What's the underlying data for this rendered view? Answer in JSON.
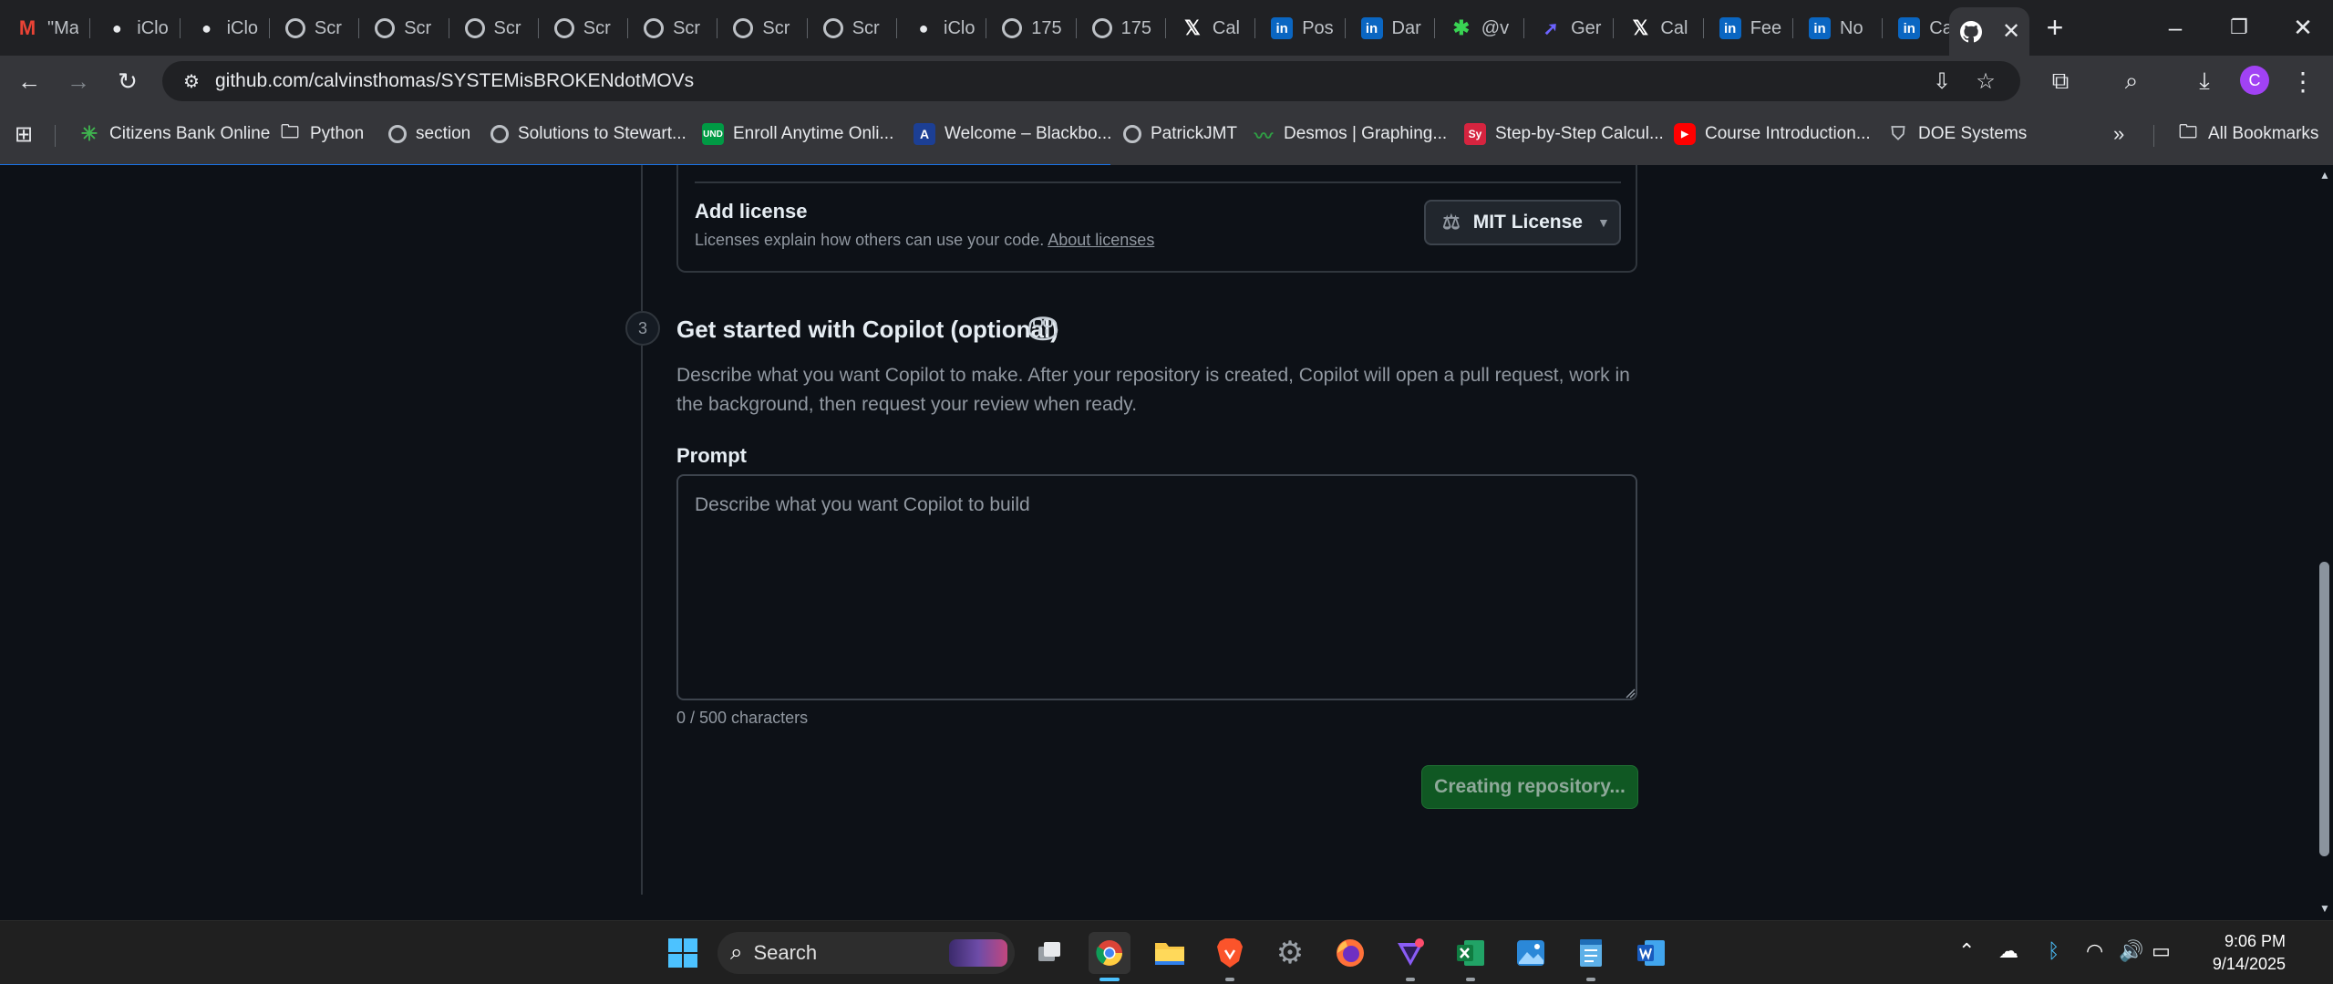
{
  "browser": {
    "tabs": [
      {
        "label": "\"Ma",
        "favicon": "gmail-icon"
      },
      {
        "label": "iClo",
        "favicon": "apple-icon"
      },
      {
        "label": "iClo",
        "favicon": "apple-icon"
      },
      {
        "label": "Scr",
        "favicon": "globe-icon"
      },
      {
        "label": "Scr",
        "favicon": "globe-icon"
      },
      {
        "label": "Scr",
        "favicon": "globe-icon"
      },
      {
        "label": "Scr",
        "favicon": "globe-icon"
      },
      {
        "label": "Scr",
        "favicon": "globe-icon"
      },
      {
        "label": "Scr",
        "favicon": "globe-icon"
      },
      {
        "label": "Scr",
        "favicon": "globe-icon"
      },
      {
        "label": "iClo",
        "favicon": "apple-icon"
      },
      {
        "label": "175",
        "favicon": "globe-icon"
      },
      {
        "label": "175",
        "favicon": "globe-icon"
      },
      {
        "label": "Cal",
        "favicon": "x-icon"
      },
      {
        "label": "Pos",
        "favicon": "linkedin-icon"
      },
      {
        "label": "Dar",
        "favicon": "linkedin-icon"
      },
      {
        "label": "@v",
        "favicon": "star-icon"
      },
      {
        "label": "Ger",
        "favicon": "arrow-icon"
      },
      {
        "label": "Cal",
        "favicon": "x-icon"
      },
      {
        "label": "Fee",
        "favicon": "linkedin-icon"
      },
      {
        "label": "No",
        "favicon": "linkedin-icon"
      },
      {
        "label": "Cal",
        "favicon": "linkedin-icon"
      }
    ],
    "active_tab_favicon": "github-icon",
    "url": "github.com/calvinsthomas/SYSTEMisBROKENdotMOVs",
    "profile_initial": "C",
    "bookmarks": [
      {
        "label": "Citizens Bank Online",
        "icon": "citizens-icon"
      },
      {
        "label": "Python",
        "icon": "folder-icon"
      },
      {
        "label": "section",
        "icon": "globe-icon"
      },
      {
        "label": "Solutions to Stewart...",
        "icon": "globe-icon"
      },
      {
        "label": "Enroll Anytime Onli...",
        "icon": "und-icon",
        "badge": "UND"
      },
      {
        "label": "Welcome – Blackbo...",
        "icon": "blackboard-icon",
        "badge": "A"
      },
      {
        "label": "PatrickJMT",
        "icon": "globe-icon"
      },
      {
        "label": "Desmos | Graphing...",
        "icon": "desmos-icon"
      },
      {
        "label": "Step-by-Step Calcul...",
        "icon": "symbolab-icon",
        "badge": "Sy"
      },
      {
        "label": "Course Introduction...",
        "icon": "youtube-icon"
      },
      {
        "label": "DOE Systems",
        "icon": "shield-icon"
      }
    ],
    "all_bookmarks_label": "All Bookmarks"
  },
  "license": {
    "title": "Add license",
    "description": "Licenses explain how others can use your code.",
    "link": "About licenses",
    "selected": "MIT License"
  },
  "copilot": {
    "step_number": "3",
    "title": "Get started with Copilot (optional)",
    "description": "Describe what you want Copilot to make. After your repository is created, Copilot will open a pull request, work in the background, then request your review when ready.",
    "prompt_label": "Prompt",
    "prompt_placeholder": "Describe what you want Copilot to build",
    "prompt_value": "",
    "char_count": "0 / 500 characters"
  },
  "submit": {
    "label": "Creating repository...",
    "colors": {
      "bg": "#105823",
      "text": "#8fa99a"
    }
  },
  "taskbar": {
    "search_label": "Search",
    "time": "9:06 PM",
    "date": "9/14/2025"
  },
  "colors": {
    "page_bg": "#0d1117",
    "border": "#30363d",
    "muted_text": "#9198a1",
    "progress": "#1a73e8",
    "loading_progress": 0.476
  }
}
